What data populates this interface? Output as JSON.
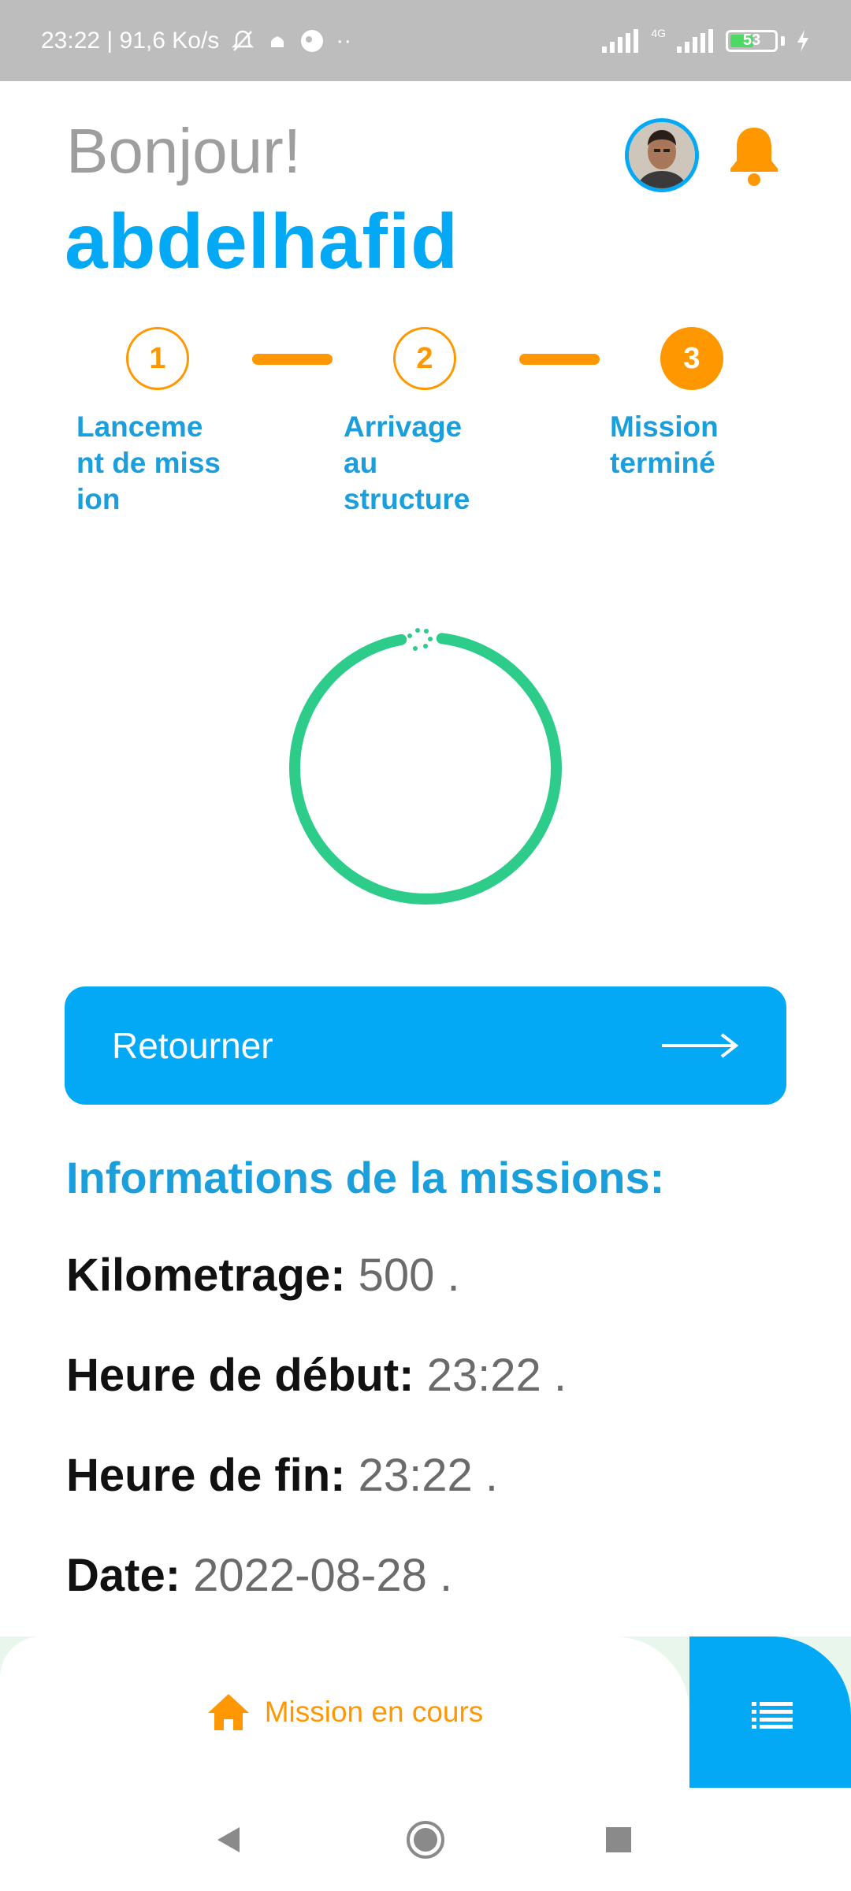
{
  "status_bar": {
    "time_speed": "23:22 | 91,6 Ko/s",
    "network_label": "4G",
    "battery": "53"
  },
  "header": {
    "greeting": "Bonjour!",
    "username": "abdelhafid",
    "avatar_icon": "user-avatar",
    "notification_icon": "bell-icon"
  },
  "stepper": {
    "steps": [
      {
        "number": "1",
        "label": "Lanceme nt de mission",
        "state": "done"
      },
      {
        "number": "2",
        "label": "Arrivage au structure",
        "state": "done"
      },
      {
        "number": "3",
        "label": "Mission terminé",
        "state": "active"
      }
    ]
  },
  "progress": {
    "value": 0.95,
    "color": "#2ecc8a"
  },
  "actions": {
    "return_label": "Retourner",
    "return_icon": "arrow-right-icon"
  },
  "mission_info": {
    "title": "Informations de la missions:",
    "rows": [
      {
        "label": "Kilometrage:",
        "value": "500 ."
      },
      {
        "label": "Heure de début:",
        "value": "23:22 ."
      },
      {
        "label": "Heure de fin:",
        "value": "23:22 ."
      },
      {
        "label": "Date:",
        "value": "2022-08-28 ."
      }
    ]
  },
  "bottom_nav": {
    "current_label": "Mission en cours",
    "current_icon": "home-icon",
    "menu_icon": "list-icon"
  },
  "colors": {
    "primary": "#03a9f4",
    "accent": "#ff9800",
    "success": "#2ecc8a"
  }
}
